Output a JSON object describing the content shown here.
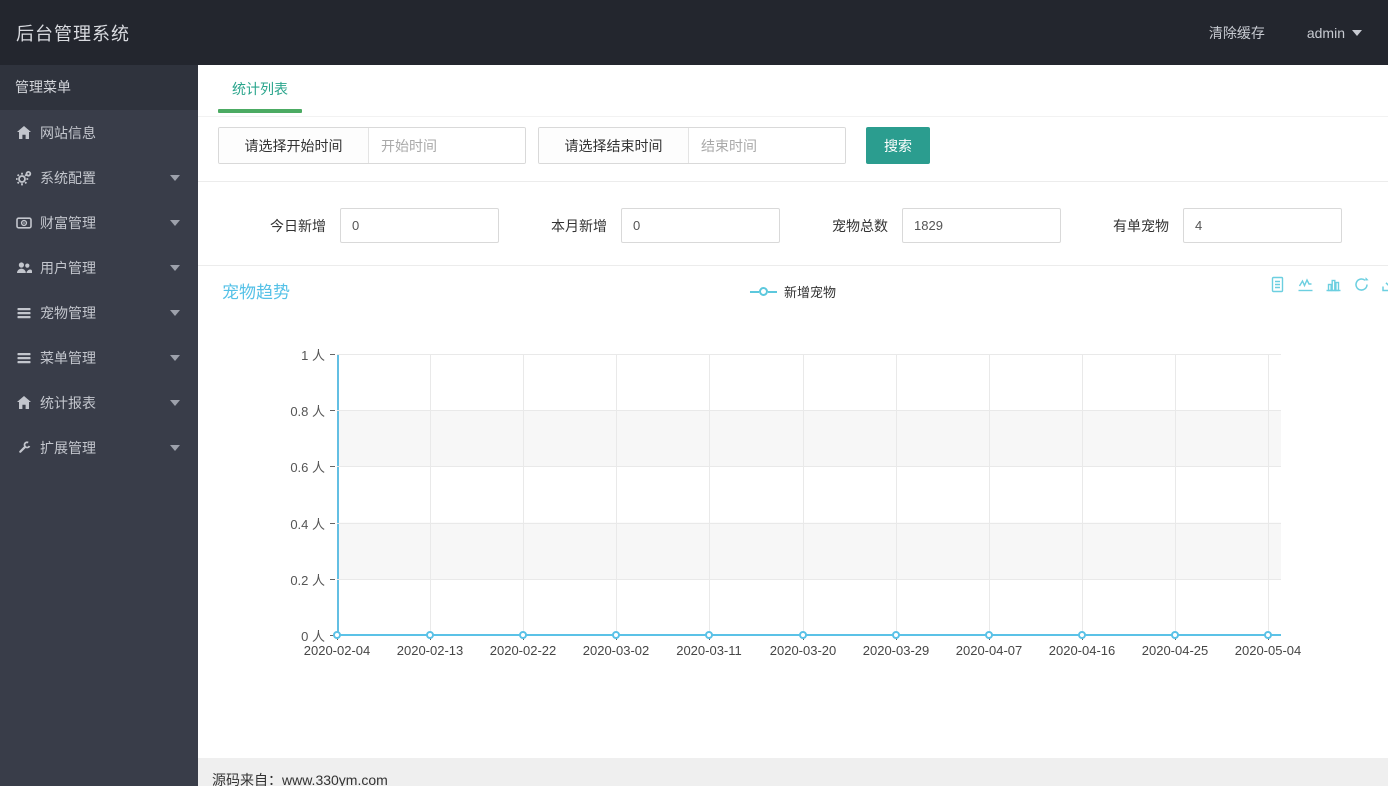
{
  "header": {
    "brand": "后台管理系统",
    "clear_cache": "清除缓存",
    "username": "admin"
  },
  "sidebar": {
    "menu_title": "管理菜单",
    "items": [
      {
        "label": "网站信息",
        "icon": "home-icon",
        "has_submenu": false
      },
      {
        "label": "系统配置",
        "icon": "gears-icon",
        "has_submenu": true
      },
      {
        "label": "财富管理",
        "icon": "money-icon",
        "has_submenu": true
      },
      {
        "label": "用户管理",
        "icon": "users-icon",
        "has_submenu": true
      },
      {
        "label": "宠物管理",
        "icon": "list-icon",
        "has_submenu": true
      },
      {
        "label": "菜单管理",
        "icon": "list-icon",
        "has_submenu": true
      },
      {
        "label": "统计报表",
        "icon": "home-icon",
        "has_submenu": true
      },
      {
        "label": "扩展管理",
        "icon": "wrench-icon",
        "has_submenu": true
      }
    ]
  },
  "tabs": {
    "active": "统计列表"
  },
  "filter": {
    "start_addon": "请选择开始时间",
    "start_placeholder": "开始时间",
    "end_addon": "请选择结束时间",
    "end_placeholder": "结束时间",
    "search_label": "搜索"
  },
  "stats": [
    {
      "label": "今日新增",
      "value": "0"
    },
    {
      "label": "本月新增",
      "value": "0"
    },
    {
      "label": "宠物总数",
      "value": "1829"
    },
    {
      "label": "有单宠物",
      "value": "4"
    }
  ],
  "chart": {
    "title": "宠物趋势",
    "legend": "新增宠物",
    "toolbox": [
      "data-view",
      "line-chart",
      "bar-chart",
      "restore",
      "save-image"
    ]
  },
  "chart_data": {
    "type": "line",
    "title": "宠物趋势",
    "categories": [
      "2020-02-04",
      "2020-02-13",
      "2020-02-22",
      "2020-03-02",
      "2020-03-11",
      "2020-03-20",
      "2020-03-29",
      "2020-04-07",
      "2020-04-16",
      "2020-04-25",
      "2020-05-04"
    ],
    "series": [
      {
        "name": "新增宠物",
        "values": [
          0,
          0,
          0,
          0,
          0,
          0,
          0,
          0,
          0,
          0,
          0
        ]
      }
    ],
    "ylim": [
      0,
      1
    ],
    "ytick_labels": [
      "0 人",
      "0.2 人",
      "0.4 人",
      "0.6 人",
      "0.8 人",
      "1 人"
    ],
    "unit": "人",
    "grid": true,
    "legend_position": "top-center",
    "line_color": "#5bc2e7"
  },
  "footer": {
    "text": "源码来自：www.330ym.com"
  },
  "colors": {
    "header_bg": "#23262e",
    "sidebar_bg": "#393d49",
    "accent_teal": "#2b9d8f",
    "tab_underline_green": "#4cab63",
    "chart_cyan": "#5bc2e7",
    "footer_bg": "#efefef"
  }
}
